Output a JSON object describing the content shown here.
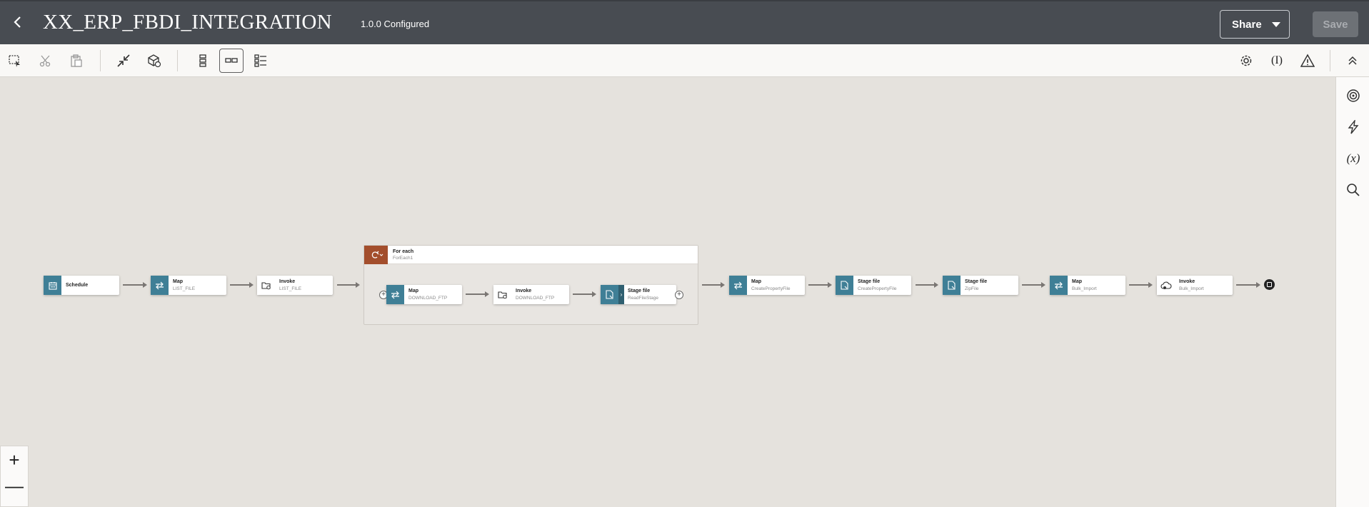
{
  "header": {
    "title": "XX_ERP_FBDI_INTEGRATION",
    "version": "1.0.0 Configured",
    "share_label": "Share",
    "save_label": "Save"
  },
  "toolbar": {
    "left_icons": [
      "select-icon",
      "cut-icon",
      "paste-icon",
      "collapse-icon",
      "package-icon",
      "vertical-layout-icon",
      "horizontal-layout-icon",
      "pseudo-layout-icon"
    ],
    "right_icons": [
      "gear-icon",
      "tracking-icon",
      "warning-icon",
      "collapse-up-icon"
    ]
  },
  "rail": {
    "icons": [
      "target-icon",
      "lightning-icon",
      "variables-icon",
      "search-icon"
    ],
    "variables_label": "(x)",
    "tracking_label": "(I)"
  },
  "zoom": {
    "in": "+",
    "out": "—"
  },
  "flow": {
    "schedule": {
      "title": "Schedule"
    },
    "map_list": {
      "title": "Map",
      "sub": "LIST_FILE"
    },
    "invoke_list": {
      "title": "Invoke",
      "sub": "LIST_FILE"
    },
    "foreach": {
      "title": "For each",
      "sub": "ForEach1"
    },
    "map_download": {
      "title": "Map",
      "sub": "DOWNLOAD_FTP"
    },
    "invoke_download": {
      "title": "Invoke",
      "sub": "DOWNLOAD_FTP"
    },
    "stage_read": {
      "title": "Stage file",
      "sub": "ReadFileStage"
    },
    "map_create": {
      "title": "Map",
      "sub": "CreatePropertyFile"
    },
    "stage_create": {
      "title": "Stage file",
      "sub": "CreatePropertyFile"
    },
    "stage_zip": {
      "title": "Stage file",
      "sub": "ZipFile"
    },
    "map_bulk": {
      "title": "Map",
      "sub": "Bulk_Import"
    },
    "invoke_bulk": {
      "title": "Invoke",
      "sub": "Bulk_Import"
    }
  },
  "colors": {
    "header_bg": "#484c52",
    "node_teal": "#3f7f96",
    "foreach_brown": "#a34e2c",
    "canvas_bg": "#e5e2dd"
  }
}
